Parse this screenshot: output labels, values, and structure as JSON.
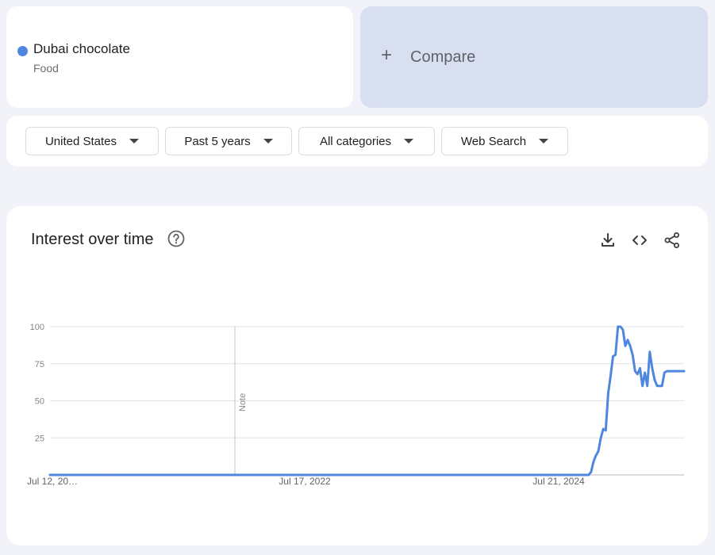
{
  "search_term": {
    "name": "Dubai chocolate",
    "category": "Food",
    "color": "#4f87e0"
  },
  "compare": {
    "label": "Compare"
  },
  "filters": {
    "region": "United States",
    "time_range": "Past 5 years",
    "category": "All categories",
    "search_type": "Web Search"
  },
  "chart": {
    "title": "Interest over time",
    "help_icon": "help-circle-icon",
    "toolbar": [
      "download-icon",
      "embed-code-icon",
      "share-icon"
    ]
  },
  "chart_data": {
    "type": "line",
    "title": "Interest over time",
    "x_tick_labels": [
      "Jul 12, 20…",
      "Jul 17, 2022",
      "Jul 21, 2024"
    ],
    "y_ticks": [
      25,
      50,
      75,
      100
    ],
    "ylim": [
      0,
      100
    ],
    "grid": true,
    "note_label": "Note",
    "series": [
      {
        "name": "Dubai chocolate",
        "color": "#4f87e0",
        "x": [
          "2020-07-12",
          "2021-01-03",
          "2021-07-04",
          "2022-01-02",
          "2022-07-17",
          "2023-01-01",
          "2023-07-02",
          "2024-01-07",
          "2024-07-21",
          "2024-09-08",
          "2024-09-29",
          "2024-10-06",
          "2024-10-13",
          "2024-10-20",
          "2024-10-27",
          "2024-11-03",
          "2024-11-10",
          "2024-11-17",
          "2024-11-24",
          "2024-12-01",
          "2024-12-08",
          "2024-12-15",
          "2024-12-22",
          "2024-12-29",
          "2025-01-05",
          "2025-01-12",
          "2025-01-19",
          "2025-01-26",
          "2025-02-02",
          "2025-02-09",
          "2025-02-16",
          "2025-02-23",
          "2025-03-02",
          "2025-03-09",
          "2025-03-16",
          "2025-03-23",
          "2025-03-30",
          "2025-04-06",
          "2025-04-13",
          "2025-04-20",
          "2025-04-27",
          "2025-05-04",
          "2025-05-11",
          "2025-05-18",
          "2025-05-25",
          "2025-06-01",
          "2025-06-08",
          "2025-06-15",
          "2025-06-22",
          "2025-06-29"
        ],
        "values": [
          0,
          0,
          0,
          0,
          0,
          0,
          0,
          0,
          0,
          0,
          0,
          2,
          9,
          13,
          16,
          25,
          31,
          30,
          55,
          67,
          80,
          81,
          100,
          100,
          98,
          87,
          91,
          87,
          81,
          70,
          68,
          72,
          60,
          69,
          60,
          83,
          72,
          64,
          60,
          60,
          60,
          69,
          70,
          70,
          70,
          70,
          70,
          70,
          70,
          70
        ]
      }
    ]
  }
}
